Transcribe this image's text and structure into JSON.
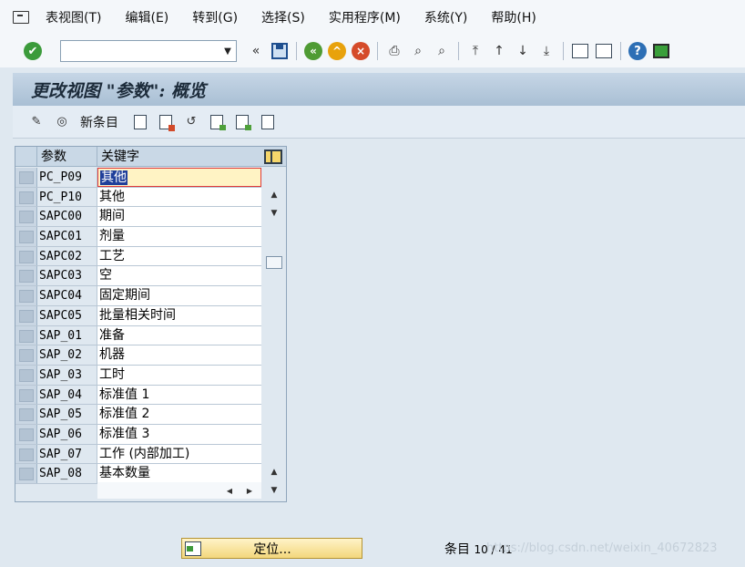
{
  "menubar": {
    "items": [
      "表视图(T)",
      "编辑(E)",
      "转到(G)",
      "选择(S)",
      "实用程序(M)",
      "系统(Y)",
      "帮助(H)"
    ]
  },
  "toolbar": {
    "command_value": "",
    "icons": [
      "enter-check",
      "save",
      "back",
      "exit",
      "cancel",
      "print",
      "find",
      "find-next",
      "first-page",
      "previous-page",
      "next-page",
      "last-page",
      "create-session",
      "create-shortcut",
      "help",
      "customize-layout"
    ]
  },
  "title": "更改视图 \"参数\": 概览",
  "app_toolbar": {
    "new_entries_label": "新条目"
  },
  "table": {
    "columns": [
      "参数",
      "关键字"
    ],
    "rows": [
      {
        "key": "PC_P09",
        "keyword": "其他"
      },
      {
        "key": "PC_P10",
        "keyword": "其他"
      },
      {
        "key": "SAPC00",
        "keyword": "期间"
      },
      {
        "key": "SAPC01",
        "keyword": "剂量"
      },
      {
        "key": "SAPC02",
        "keyword": "工艺"
      },
      {
        "key": "SAPC03",
        "keyword": "空"
      },
      {
        "key": "SAPC04",
        "keyword": "固定期间"
      },
      {
        "key": "SAPC05",
        "keyword": "批量相关时间"
      },
      {
        "key": "SAP_01",
        "keyword": "准备"
      },
      {
        "key": "SAP_02",
        "keyword": "机器"
      },
      {
        "key": "SAP_03",
        "keyword": "工时"
      },
      {
        "key": "SAP_04",
        "keyword": "标准值 1"
      },
      {
        "key": "SAP_05",
        "keyword": "标准值 2"
      },
      {
        "key": "SAP_06",
        "keyword": "标准值 3"
      },
      {
        "key": "SAP_07",
        "keyword": "工作 (内部加工)"
      },
      {
        "key": "SAP_08",
        "keyword": "基本数量"
      }
    ]
  },
  "position_button_label": "定位...",
  "entry": {
    "label": "条目",
    "value": "10 / 41"
  },
  "watermark": "https://blog.csdn.net/weixin_40672823"
}
